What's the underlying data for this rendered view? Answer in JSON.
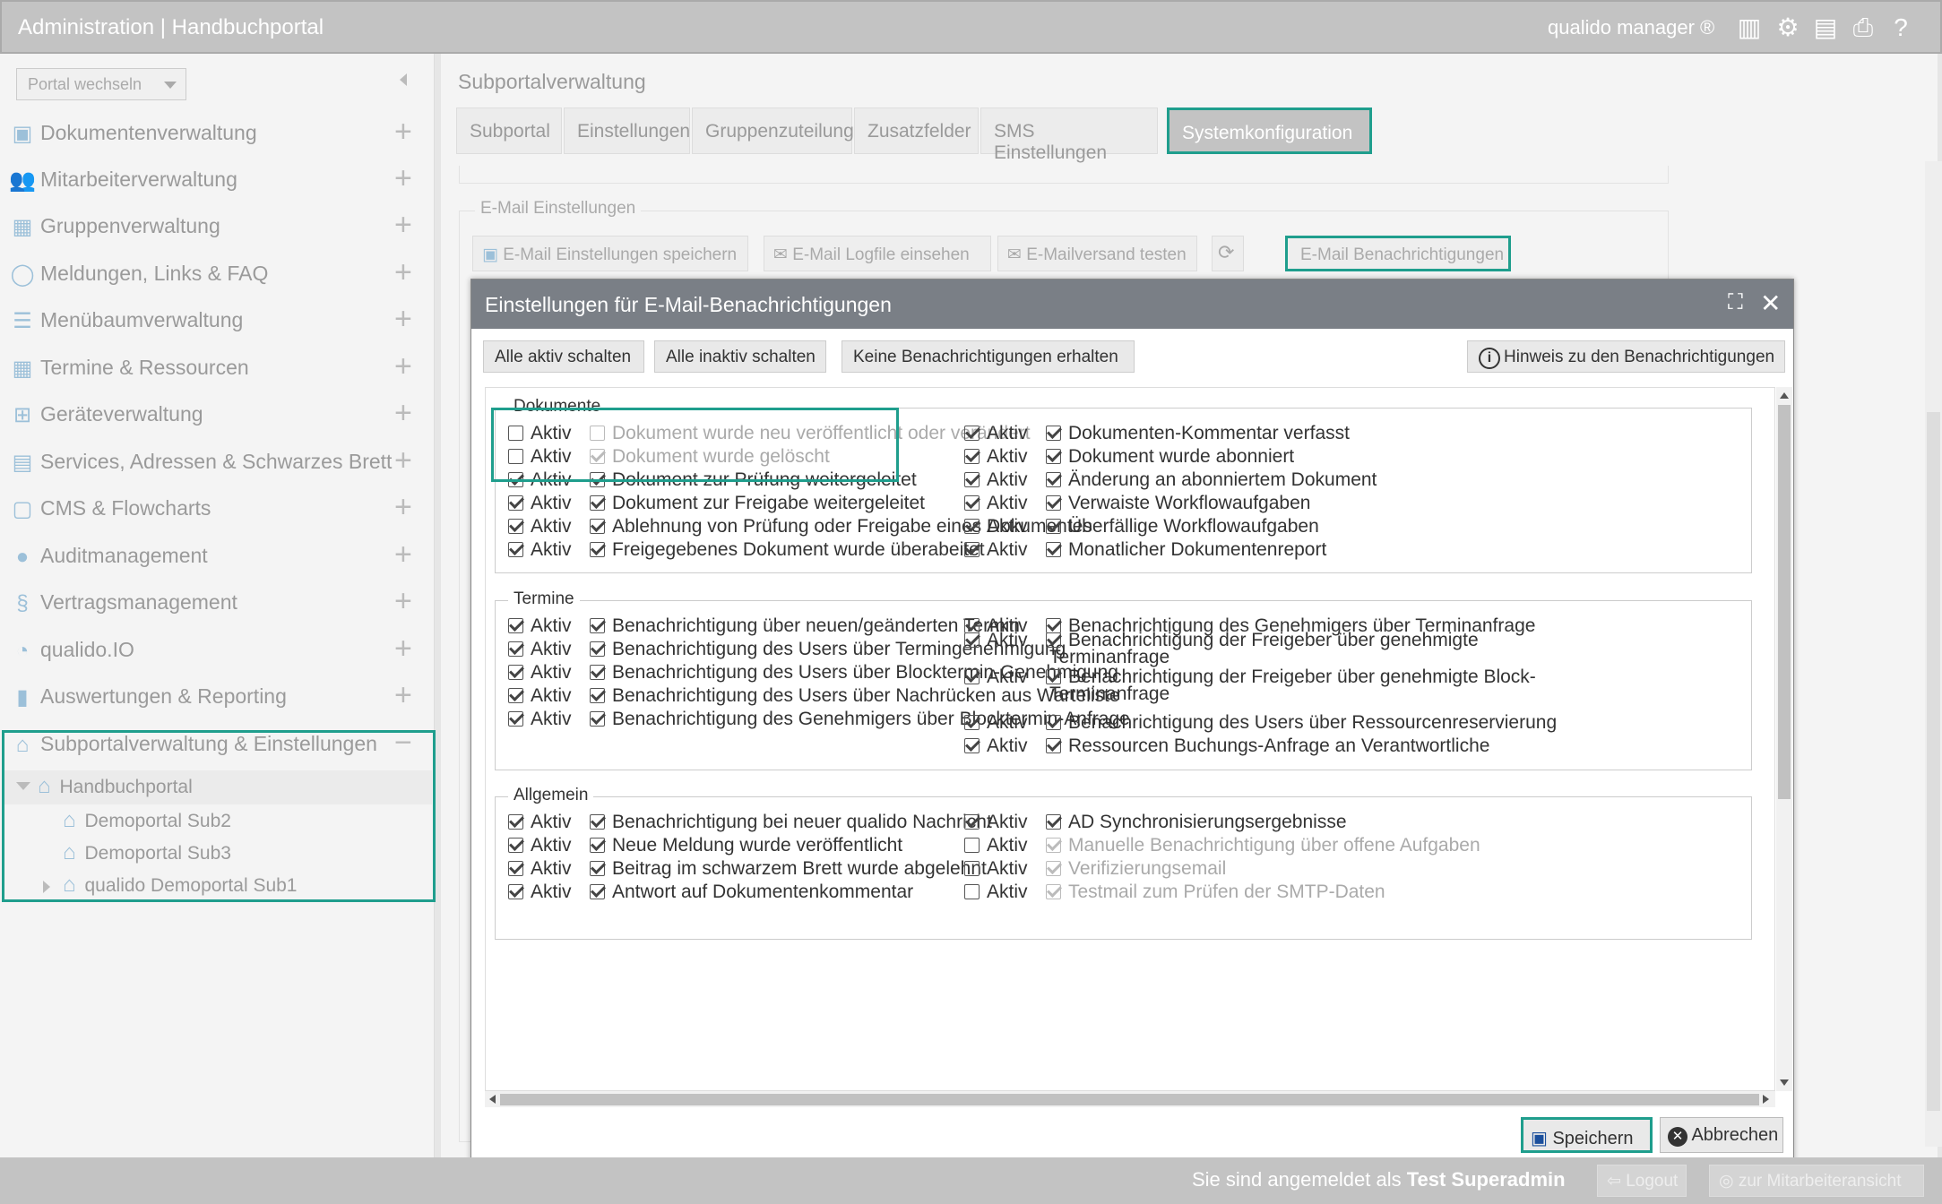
{
  "header": {
    "title": "Administration | Handbuchportal",
    "brand": "qualido manager ®"
  },
  "sidebar": {
    "portal_select": "Portal wechseln",
    "items": [
      {
        "label": "Dokumentenverwaltung",
        "icon": "documents-icon"
      },
      {
        "label": "Mitarbeiterverwaltung",
        "icon": "users-icon"
      },
      {
        "label": "Gruppenverwaltung",
        "icon": "groups-icon"
      },
      {
        "label": "Meldungen, Links & FAQ",
        "icon": "speech-bubble-icon"
      },
      {
        "label": "Menübaumverwaltung",
        "icon": "list-icon"
      },
      {
        "label": "Termine & Ressourcen",
        "icon": "calendar-icon"
      },
      {
        "label": "Geräteverwaltung",
        "icon": "device-icon"
      },
      {
        "label": "Services, Adressen & Schwarzes Brett",
        "icon": "address-book-icon"
      },
      {
        "label": "CMS & Flowcharts",
        "icon": "flowchart-icon"
      },
      {
        "label": "Auditmanagement",
        "icon": "auditor-icon"
      },
      {
        "label": "Vertragsmanagement",
        "icon": "paragraph-icon"
      },
      {
        "label": "qualido.IO",
        "icon": "io-icon"
      },
      {
        "label": "Auswertungen & Reporting",
        "icon": "bar-chart-icon"
      },
      {
        "label": "Subportalverwaltung & Einstellungen",
        "icon": "house-icon"
      }
    ],
    "tree": {
      "root": "Handbuchportal",
      "children": [
        "Demoportal Sub2",
        "Demoportal Sub3",
        "qualido Demoportal Sub1"
      ]
    }
  },
  "main": {
    "breadcrumb": "Subportalverwaltung",
    "tabs": [
      "Subportal",
      "Einstellungen",
      "Gruppenzuteilung",
      "Zusatzfelder",
      "SMS Einstellungen",
      "Systemkonfiguration"
    ],
    "email_section": {
      "legend": "E-Mail Einstellungen",
      "buttons": [
        "E-Mail Einstellungen speichern",
        "E-Mail Logfile einsehen",
        "E-Mailversand testen",
        "E-Mail Benachrichtigungen"
      ]
    }
  },
  "modal": {
    "title": "Einstellungen für E-Mail-Benachrichtigungen",
    "toolbar": [
      "Alle aktiv schalten",
      "Alle inaktiv schalten",
      "Keine Benachrichtigungen erhalten"
    ],
    "hint_button": "Hinweis zu den Benachrichtigungen",
    "aktiv_label": "Aktiv",
    "sections": [
      {
        "legend": "Dokumente",
        "left": [
          {
            "aktiv": false,
            "checked": false,
            "disabled": true,
            "label": "Dokument wurde neu veröffentlicht oder verändert"
          },
          {
            "aktiv": false,
            "checked": true,
            "disabled": true,
            "label": "Dokument wurde gelöscht"
          },
          {
            "aktiv": true,
            "checked": true,
            "disabled": false,
            "label": "Dokument zur Prüfung weitergeleitet"
          },
          {
            "aktiv": true,
            "checked": true,
            "disabled": false,
            "label": "Dokument zur Freigabe weitergeleitet"
          },
          {
            "aktiv": true,
            "checked": true,
            "disabled": false,
            "label": "Ablehnung von Prüfung oder Freigabe eines Dokumentes"
          },
          {
            "aktiv": true,
            "checked": true,
            "disabled": false,
            "label": "Freigegebenes Dokument wurde überabeitet"
          }
        ],
        "right": [
          {
            "aktiv": true,
            "checked": true,
            "disabled": false,
            "label": "Dokumenten-Kommentar verfasst"
          },
          {
            "aktiv": true,
            "checked": true,
            "disabled": false,
            "label": "Dokument wurde abonniert"
          },
          {
            "aktiv": true,
            "checked": true,
            "disabled": false,
            "label": "Änderung an abonniertem Dokument"
          },
          {
            "aktiv": true,
            "checked": true,
            "disabled": false,
            "label": "Verwaiste Workflowaufgaben"
          },
          {
            "aktiv": true,
            "checked": true,
            "disabled": false,
            "label": "Überfällige Workflowaufgaben"
          },
          {
            "aktiv": true,
            "checked": true,
            "disabled": false,
            "label": "Monatlicher Dokumentenreport"
          }
        ]
      },
      {
        "legend": "Termine",
        "left": [
          {
            "aktiv": true,
            "checked": true,
            "disabled": false,
            "label": "Benachrichtigung über neuen/geänderten Termin"
          },
          {
            "aktiv": true,
            "checked": true,
            "disabled": false,
            "label": "Benachrichtigung des Users über Termingenehmigung"
          },
          {
            "aktiv": true,
            "checked": true,
            "disabled": false,
            "label": "Benachrichtigung des Users über Blocktermin-Genehmigung"
          },
          {
            "aktiv": true,
            "checked": true,
            "disabled": false,
            "label": "Benachrichtigung des Users über Nachrücken aus Warteliste"
          },
          {
            "aktiv": true,
            "checked": true,
            "disabled": false,
            "label": "Benachrichtigung des Genehmigers über Blocktermin-Anfrage"
          }
        ],
        "right": [
          {
            "aktiv": true,
            "checked": true,
            "disabled": false,
            "label": "Benachrichtigung des Genehmigers über Terminanfrage"
          },
          {
            "aktiv": true,
            "checked": true,
            "disabled": false,
            "label": "Benachrichtigung der Freigeber über genehmigte",
            "label2": "Terminanfrage"
          },
          {
            "aktiv": true,
            "checked": true,
            "disabled": false,
            "label": "Benachrichtigung der Freigeber über genehmigte Block-",
            "label2": "Terminanfrage"
          },
          {
            "aktiv": true,
            "checked": true,
            "disabled": false,
            "label": "Benachrichtigung des Users über Ressourcenreservierung"
          },
          {
            "aktiv": true,
            "checked": true,
            "disabled": false,
            "label": "Ressourcen Buchungs-Anfrage an Verantwortliche"
          }
        ]
      },
      {
        "legend": "Allgemein",
        "left": [
          {
            "aktiv": true,
            "checked": true,
            "disabled": false,
            "label": "Benachrichtigung bei neuer qualido Nachricht"
          },
          {
            "aktiv": true,
            "checked": true,
            "disabled": false,
            "label": "Neue Meldung wurde veröffentlicht"
          },
          {
            "aktiv": true,
            "checked": true,
            "disabled": false,
            "label": "Beitrag im schwarzem Brett wurde abgelehnt"
          },
          {
            "aktiv": true,
            "checked": true,
            "disabled": false,
            "label": "Antwort auf Dokumentenkommentar"
          }
        ],
        "right": [
          {
            "aktiv": true,
            "checked": true,
            "disabled": false,
            "label": "AD Synchronisierungsergebnisse"
          },
          {
            "aktiv": false,
            "checked": true,
            "disabled": true,
            "label": "Manuelle Benachrichtigung über offene Aufgaben"
          },
          {
            "aktiv": false,
            "checked": true,
            "disabled": true,
            "label": "Verifizierungsemail"
          },
          {
            "aktiv": false,
            "checked": true,
            "disabled": true,
            "label": "Testmail zum Prüfen der SMTP-Daten"
          }
        ]
      }
    ],
    "save_label": "Speichern",
    "cancel_label": "Abbrechen"
  },
  "footer": {
    "logged_in_prefix": "Sie sind angemeldet als",
    "user": "Test Superadmin",
    "logout_label": "Logout",
    "employee_view_label": "zur Mitarbeiteransicht"
  },
  "colors": {
    "accent": "#1f9e8d",
    "topbar": "#c3c3c3",
    "modal_header": "#7a7f86",
    "sidebar_icon": "#9cc0d9"
  }
}
